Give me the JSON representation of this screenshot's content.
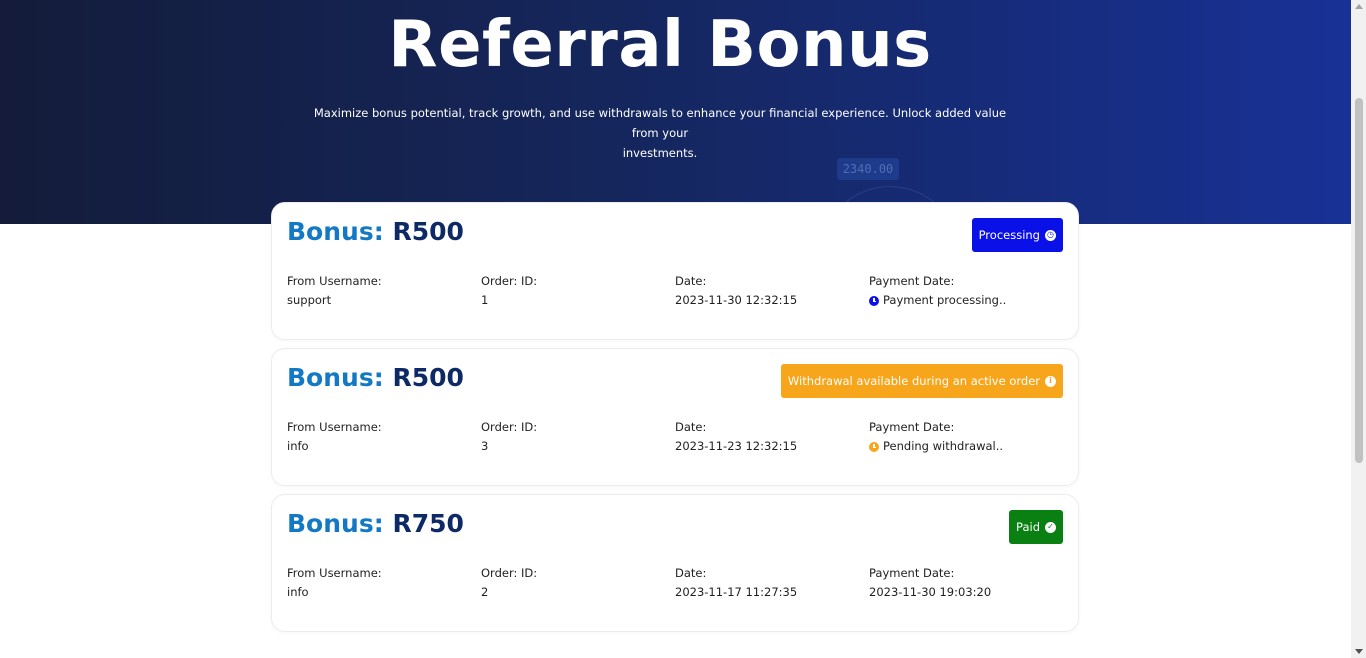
{
  "hero": {
    "title": "Referral Bonus",
    "subtitle_line1": "Maximize bonus potential, track growth, and use withdrawals to enhance your financial experience. Unlock added value from your",
    "subtitle_line2": "investments.",
    "background_ghost_text": "2340.00"
  },
  "labels": {
    "bonus": "Bonus:",
    "from_username": "From Username:",
    "order_id": "Order: ID:",
    "date": "Date:",
    "payment_date": "Payment Date:"
  },
  "bonuses": [
    {
      "amount": "R500",
      "status_label": "Processing",
      "status_icon": "clock-icon",
      "status_color": "#0a10e8",
      "from_username": "support",
      "order_id": "1",
      "date": "2023-11-30 12:32:15",
      "payment_date": "Payment processing..",
      "payment_icon": "clock-icon"
    },
    {
      "amount": "R500",
      "status_label": "Withdrawal available during an active order",
      "status_icon": "info-icon",
      "status_color": "#f7a51b",
      "from_username": "info",
      "order_id": "3",
      "date": "2023-11-23 12:32:15",
      "payment_date": "Pending withdrawal..",
      "payment_icon": "clock-icon"
    },
    {
      "amount": "R750",
      "status_label": "Paid",
      "status_icon": "check-circle-icon",
      "status_color": "#0a7f12",
      "from_username": "info",
      "order_id": "2",
      "date": "2023-11-17 11:27:35",
      "payment_date": "2023-11-30 19:03:20",
      "payment_icon": ""
    }
  ],
  "colors": {
    "bonus_label": "#1479c4",
    "bonus_amount": "#0e2a66",
    "hero_start": "#141c3a",
    "hero_end": "#183196"
  }
}
